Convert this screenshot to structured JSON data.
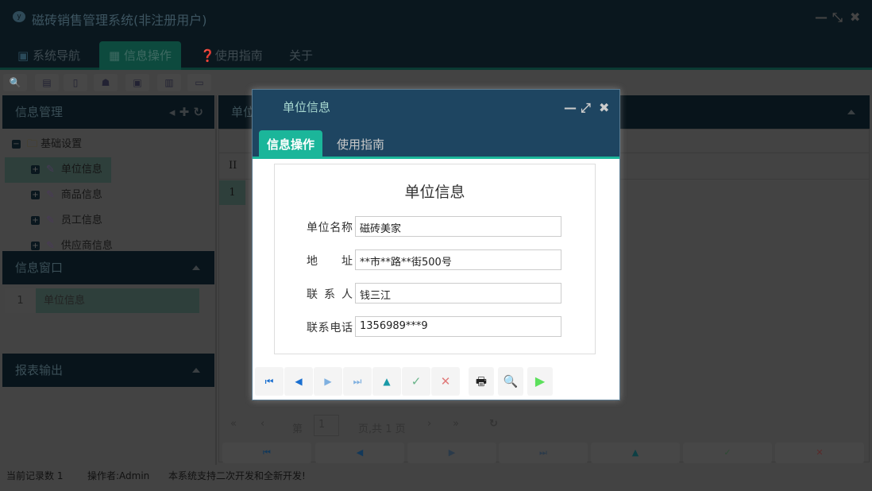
{
  "app": {
    "title": "磁砖销售管理系统(非注册用户)",
    "logo": "yf"
  },
  "nav": {
    "tabs": [
      {
        "label": "系统导航"
      },
      {
        "label": "信息操作"
      },
      {
        "label": "使用指南"
      },
      {
        "label": "关于"
      }
    ]
  },
  "left": {
    "info_mgmt": {
      "title": "信息管理",
      "tree": {
        "root": "基础设置",
        "items": [
          "单位信息",
          "商品信息",
          "员工信息",
          "供应商信息"
        ]
      }
    },
    "info_window": {
      "title": "信息窗口",
      "rows": [
        {
          "num": "1",
          "label": "单位信息"
        }
      ]
    },
    "report": {
      "title": "报表输出"
    }
  },
  "right": {
    "title": "单位信息",
    "grid": {
      "col_header": "II",
      "rows": [
        "1"
      ]
    },
    "pager": {
      "page_prefix": "第",
      "page_value": "1",
      "page_suffix": "页,共 1 页"
    }
  },
  "dialog": {
    "title": "单位信息",
    "tabs": [
      {
        "label": "信息操作"
      },
      {
        "label": "使用指南"
      }
    ],
    "form": {
      "title": "单位信息",
      "fields": [
        {
          "label": "单位名称",
          "value": "磁砖美家"
        },
        {
          "label": "地址",
          "value": "**市**路**街500号"
        },
        {
          "label": "联系人",
          "value": "钱三江"
        },
        {
          "label": "联系电话",
          "value": "1356989***9"
        }
      ]
    }
  },
  "status": {
    "record_count": "当前记录数 1",
    "operator": "操作者:Admin",
    "message": "本系统支持二次开发和全新开发!"
  }
}
